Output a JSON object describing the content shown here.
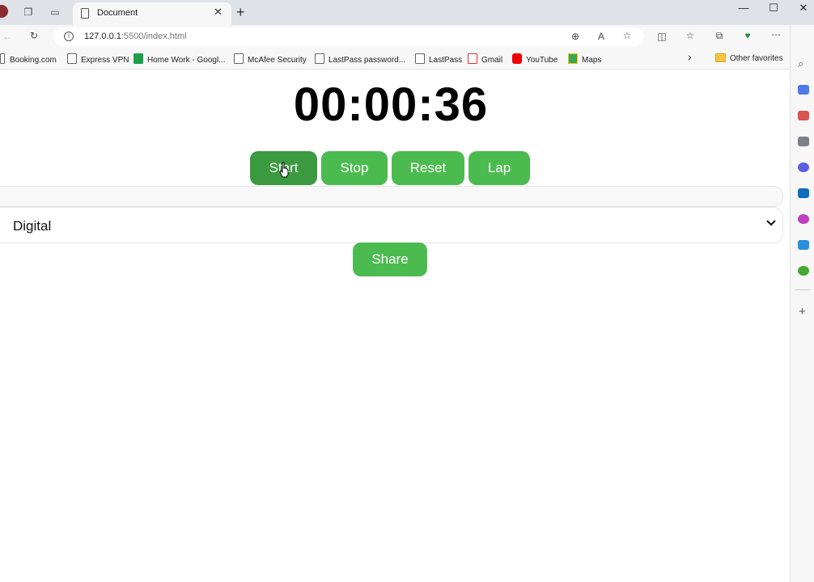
{
  "browser": {
    "tab_title": "Document",
    "tab_close": "✕",
    "new_tab": "+",
    "url_host": "127.0.0.1",
    "url_path": ":5500/index.html",
    "window_controls": {
      "minimize": "—",
      "maximize": "☐",
      "close": "✕"
    }
  },
  "bookmarks": [
    {
      "label": "Booking.com"
    },
    {
      "label": "Express VPN"
    },
    {
      "label": "Home Work - Googl..."
    },
    {
      "label": "McAfee Security"
    },
    {
      "label": "LastPass password..."
    },
    {
      "label": "LastPass"
    },
    {
      "label": "Gmail"
    },
    {
      "label": "YouTube"
    },
    {
      "label": "Maps"
    }
  ],
  "bookmarks_more": "›",
  "other_favorites": "Other favorites",
  "stopwatch": {
    "time": "00:00:36",
    "buttons": {
      "start": "Start",
      "stop": "Stop",
      "reset": "Reset",
      "lap": "Lap"
    },
    "mode_selected": "Digital",
    "share": "Share"
  },
  "colors": {
    "button": "#4cbb4f",
    "button_active": "#3b9a3f"
  }
}
